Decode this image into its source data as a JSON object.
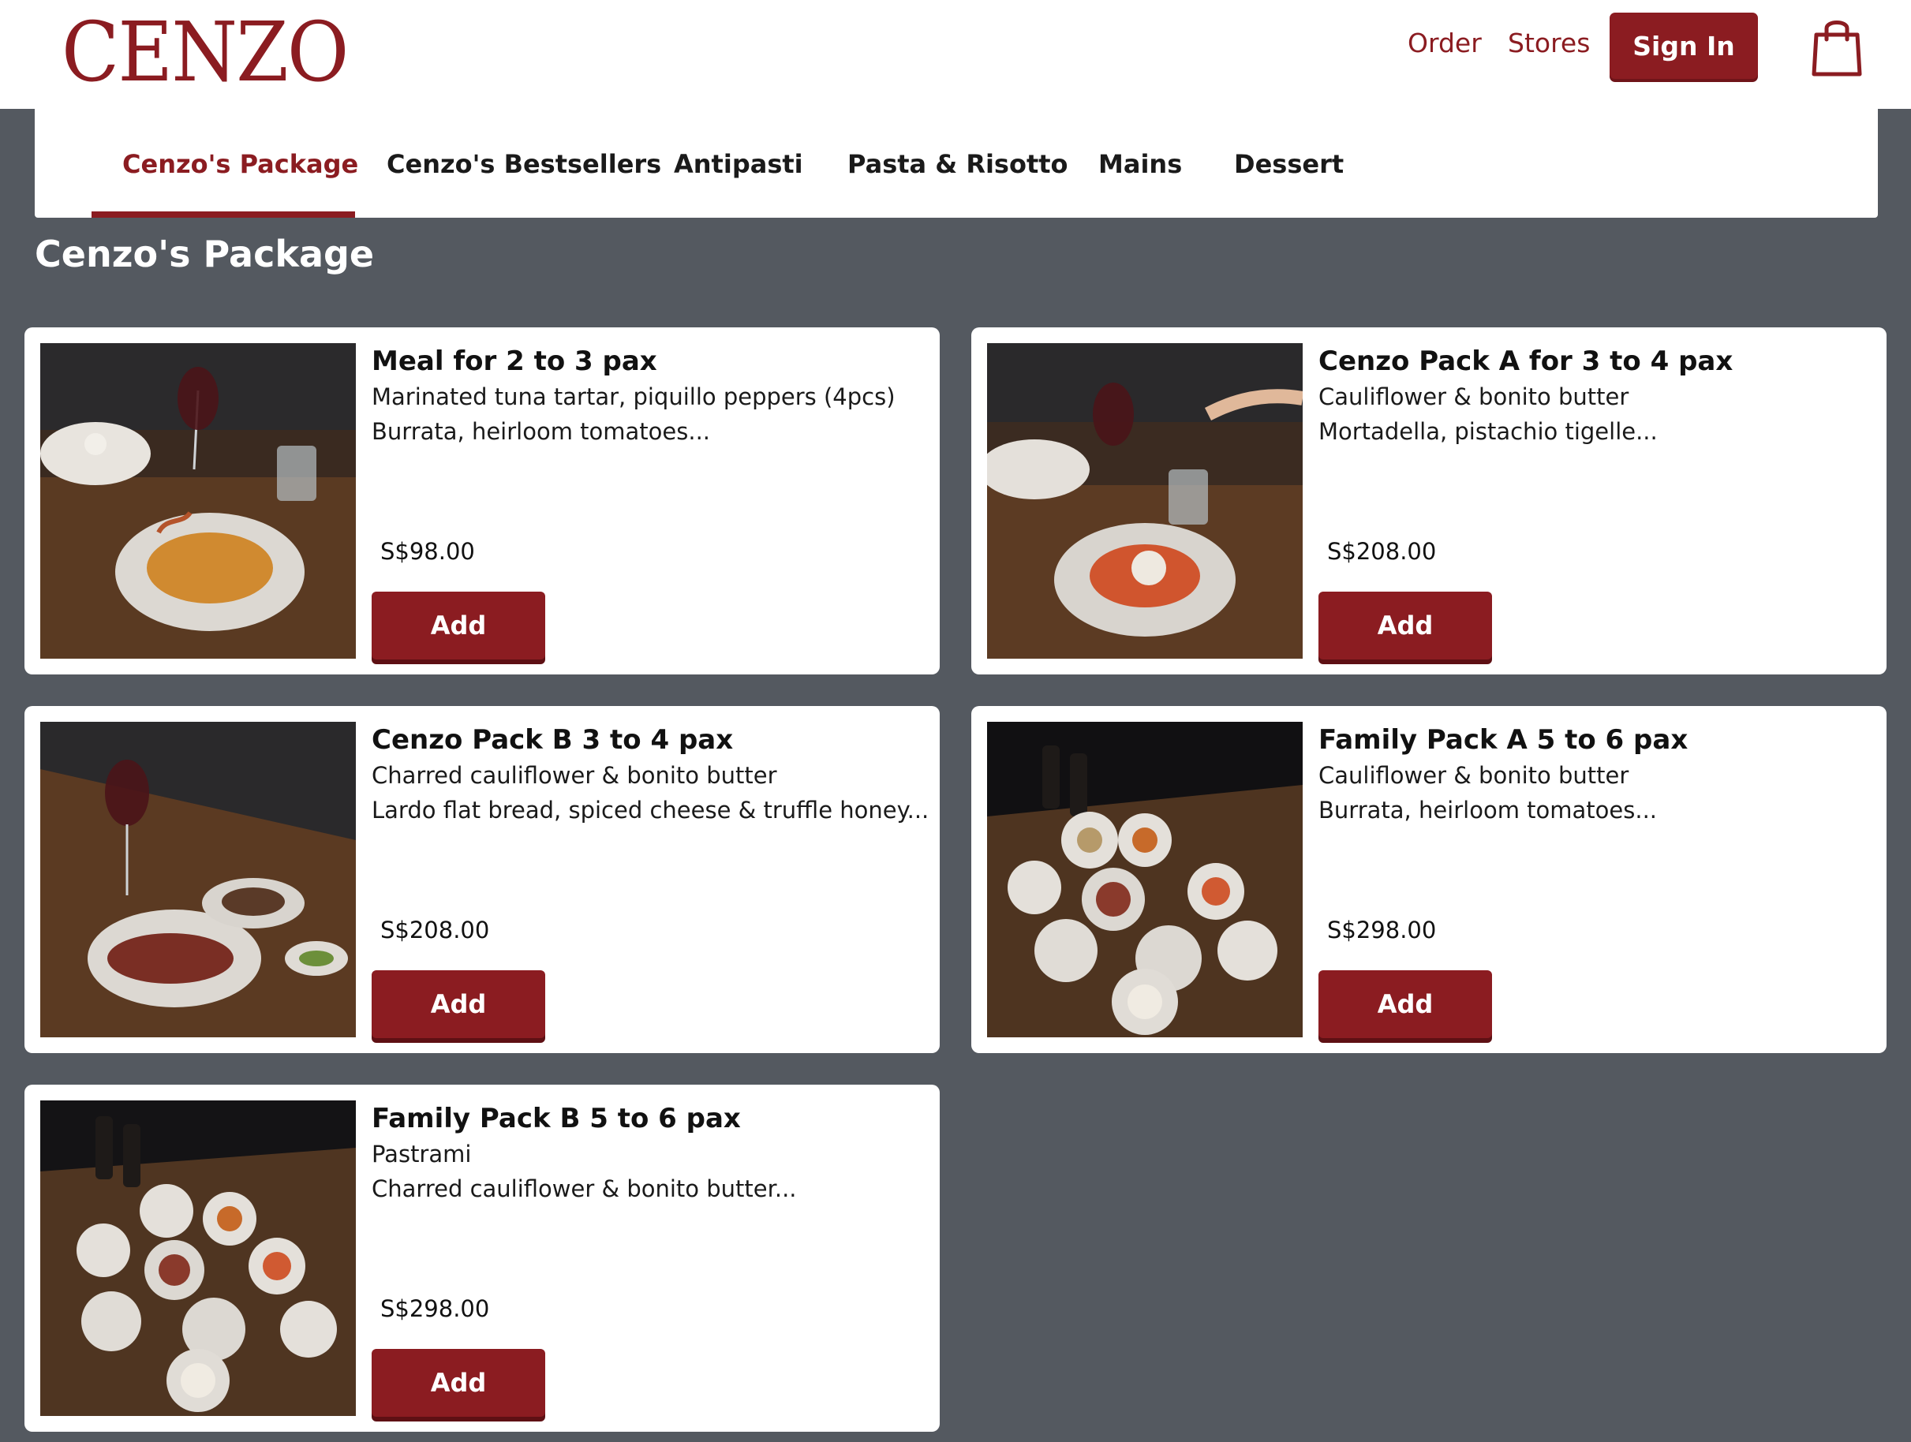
{
  "brand": {
    "logo_text": "CENZO",
    "accent_color": "#8b1c21"
  },
  "header": {
    "order_label": "Order",
    "stores_label": "Stores",
    "signin_label": "Sign In",
    "cart_icon": "shopping-bag-icon"
  },
  "tabs": [
    {
      "label": "Cenzo's Package",
      "active": true
    },
    {
      "label": "Cenzo's Bestsellers"
    },
    {
      "label": "Antipasti"
    },
    {
      "label": "Pasta & Risotto"
    },
    {
      "label": "Mains"
    },
    {
      "label": "Dessert"
    }
  ],
  "section": {
    "title": "Cenzo's Package"
  },
  "products": [
    {
      "title": "Meal for 2 to 3 pax",
      "line1": "Marinated tuna tartar, piquillo peppers (4pcs)",
      "line2": "Burrata, heirloom tomatoes...",
      "price": "S$98.00",
      "add_label": "Add"
    },
    {
      "title": "Cenzo Pack A for 3 to 4 pax",
      "line1": "Cauliflower & bonito butter",
      "line2": "Mortadella, pistachio tigelle...",
      "price": "S$208.00",
      "add_label": "Add"
    },
    {
      "title": "Cenzo Pack B 3 to 4 pax",
      "line1": "Charred cauliflower & bonito butter",
      "line2": "Lardo flat bread, spiced cheese & truffle honey...",
      "price": "S$208.00",
      "add_label": "Add"
    },
    {
      "title": "Family Pack A 5 to 6 pax",
      "line1": "Cauliflower & bonito butter",
      "line2": "Burrata, heirloom tomatoes...",
      "price": "S$298.00",
      "add_label": "Add"
    },
    {
      "title": "Family Pack B 5 to 6 pax",
      "line1": "Pastrami",
      "line2": "Charred cauliflower & bonito butter...",
      "price": "S$298.00",
      "add_label": "Add"
    }
  ]
}
